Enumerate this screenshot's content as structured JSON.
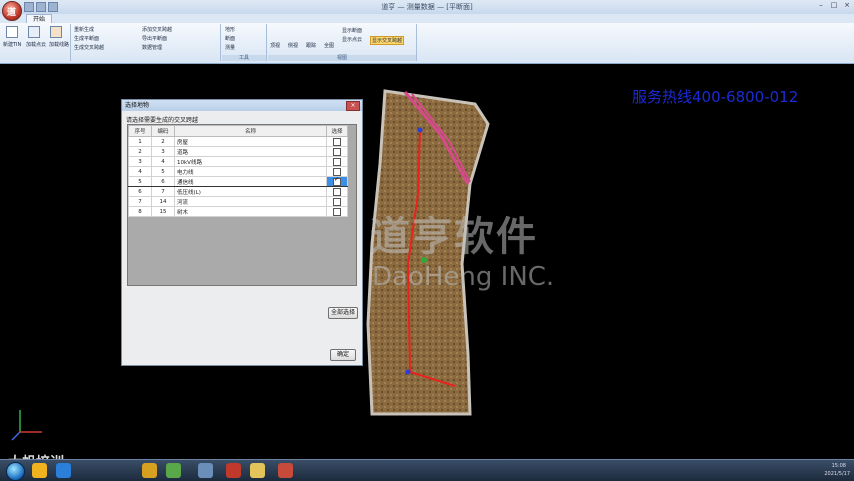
{
  "titlebar": {
    "title": "道亨 — 测量数据 — [平断面]",
    "app_logo_char": "道"
  },
  "ribbon": {
    "active_tab": "开始",
    "group_file": {
      "buttons": [
        "新建TIN",
        "加载点云",
        "加载线路"
      ]
    },
    "group_main": {
      "items": [
        "重新生成",
        "生成平断面",
        "生成交叉跨越",
        "添加交叉跨越",
        "导出平断面",
        "数据管理"
      ]
    },
    "group_tools": {
      "items": [
        "地形",
        "断面",
        "测量"
      ],
      "label": "工具"
    },
    "group_view": {
      "items": [
        "顶视",
        "侧视",
        "跟踪",
        "全图",
        "显示断面",
        "显示点云"
      ],
      "highlight": "显示交叉跨越",
      "label": "视图"
    }
  },
  "viewport": {
    "hotline": "服务热线400-6800-012",
    "watermark_cn": "道亨软件",
    "watermark_en": "DaoHeng INC."
  },
  "dialog": {
    "title": "选择地物",
    "close_label": "×",
    "hint": "请选择需要生成的交叉跨越",
    "columns": [
      "序号",
      "编码",
      "名称",
      "选择"
    ],
    "rows": [
      {
        "no": "1",
        "code": "2",
        "name": "房屋",
        "checked": false
      },
      {
        "no": "2",
        "code": "3",
        "name": "道路",
        "checked": false
      },
      {
        "no": "3",
        "code": "4",
        "name": "10kV线路",
        "checked": false
      },
      {
        "no": "4",
        "code": "5",
        "name": "电力线",
        "checked": false
      },
      {
        "no": "5",
        "code": "6",
        "name": "通信线",
        "checked": true
      },
      {
        "no": "6",
        "code": "7",
        "name": "低压线(L)",
        "checked": false
      },
      {
        "no": "7",
        "code": "14",
        "name": "河流",
        "checked": false
      },
      {
        "no": "8",
        "code": "15",
        "name": "树木",
        "checked": false
      }
    ],
    "select_all_label": "全部选择",
    "ok_label": "确定"
  },
  "brand_overlay": "大帆培训",
  "taskbar": {
    "clock_time": "15:08",
    "clock_date": "2021/5/17"
  },
  "colors": {
    "hotline": "#1a2bd6",
    "route_line": "#e8231c",
    "boundary": "#d64a8c"
  }
}
